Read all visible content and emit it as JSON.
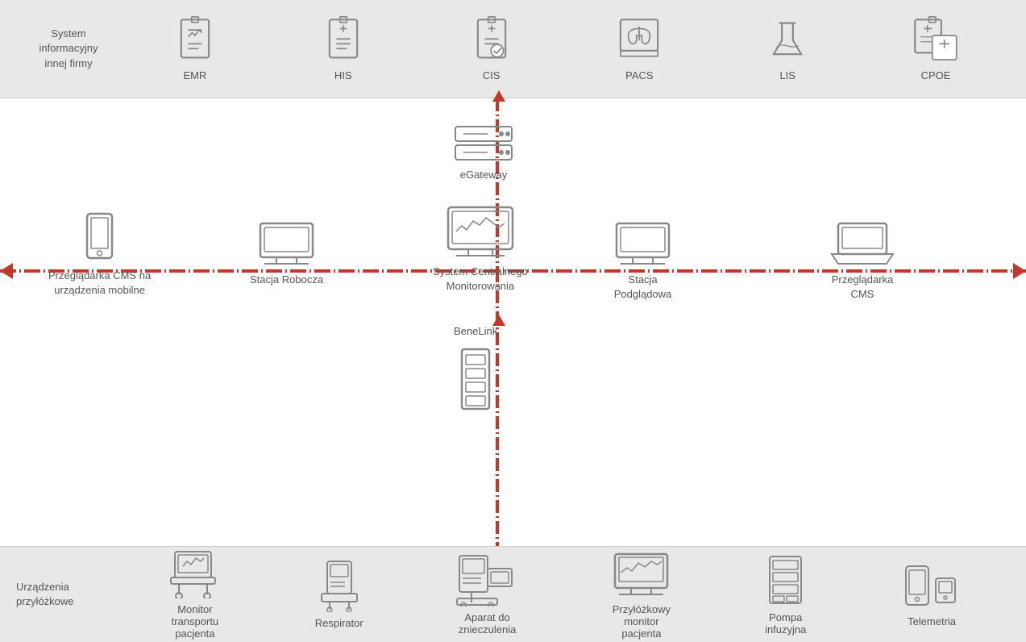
{
  "top": {
    "system_info": "System\ninformacyjny\ninnej firmy",
    "icons": [
      {
        "id": "emr",
        "label": "EMR"
      },
      {
        "id": "his",
        "label": "HIS"
      },
      {
        "id": "cis",
        "label": "CIS"
      },
      {
        "id": "pacs",
        "label": "PACS"
      },
      {
        "id": "lis",
        "label": "LIS"
      },
      {
        "id": "cpoe",
        "label": "CPOE"
      }
    ]
  },
  "middle": {
    "egateway_label": "eGateway",
    "central_label_1": "System Centralnego",
    "central_label_2": "Monitorowania",
    "stacja_rob_label": "Stacja Robocza",
    "stacja_pod_label_1": "Stacja",
    "stacja_pod_label_2": "Podglądowa",
    "przeg_mob_label_1": "Przeglądarka CMS na",
    "przeg_mob_label_2": "urządzenia mobilne",
    "przeg_cms_label": "Przeglądarka\nCMS",
    "benelink_label": "BeneLink"
  },
  "bottom": {
    "system_info": "Urządzenia\nprzyłóżkowe",
    "icons": [
      {
        "id": "monitor-transport",
        "label_1": "Monitor",
        "label_2": "transportu",
        "label_3": "pacjenta"
      },
      {
        "id": "respirator",
        "label_1": "Respirator",
        "label_2": "",
        "label_3": ""
      },
      {
        "id": "aparat",
        "label_1": "Aparat do",
        "label_2": "znieczulenia",
        "label_3": ""
      },
      {
        "id": "monitor-pacjenta",
        "label_1": "Przyłóżkowy",
        "label_2": "monitor",
        "label_3": "pacjenta"
      },
      {
        "id": "pompa",
        "label_1": "Pompa",
        "label_2": "infuzyjna",
        "label_3": ""
      },
      {
        "id": "telemetria",
        "label_1": "Telemetria",
        "label_2": "",
        "label_3": ""
      }
    ]
  },
  "colors": {
    "red": "#c0392b",
    "grey_icon": "#888",
    "text": "#555"
  }
}
